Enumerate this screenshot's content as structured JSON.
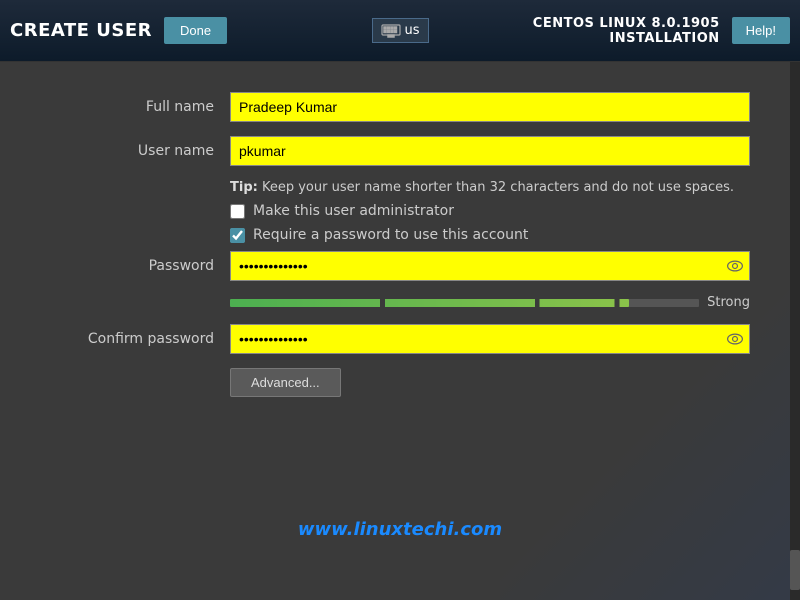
{
  "header": {
    "page_title": "CREATE USER",
    "done_label": "Done",
    "install_title": "CENTOS LINUX 8.0.1905 INSTALLATION",
    "help_label": "Help!",
    "locale": "us"
  },
  "form": {
    "full_name_label": "Full name",
    "full_name_value": "Pradeep Kumar",
    "user_name_label": "User name",
    "user_name_value": "pkumar",
    "tip_bold": "Tip:",
    "tip_text": " Keep your user name shorter than 32 characters and do not use spaces.",
    "make_admin_label": "Make this user administrator",
    "require_password_label": "Require a password to use this account",
    "password_label": "Password",
    "password_dots": "••••••••••••••",
    "confirm_label": "Confirm password",
    "confirm_dots": "••••••••••••••",
    "strength_label": "Strong",
    "advanced_label": "Advanced..."
  },
  "watermark": {
    "text": "www.linuxtechi.com"
  }
}
